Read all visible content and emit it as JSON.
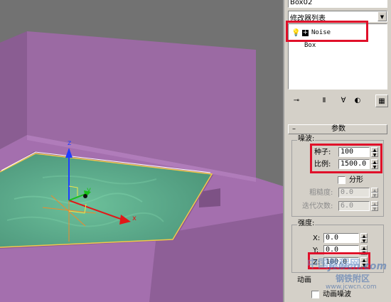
{
  "viewport": {
    "axes": {
      "x": "x",
      "y": "y",
      "z": "z"
    }
  },
  "panel": {
    "object_name": "Box02",
    "modifier_list_label": "修改器列表",
    "stack": [
      {
        "label": "Noise",
        "selected": true
      },
      {
        "label": "Box",
        "selected": false
      }
    ],
    "rollout": {
      "title": "参数",
      "noise_group": "噪波:",
      "seed_label": "种子:",
      "seed_value": "100",
      "scale_label": "比例:",
      "scale_value": "1500.0",
      "fractal_label": "分形",
      "roughness_label": "粗糙度:",
      "roughness_value": "0.0",
      "iterations_label": "迭代次数:",
      "iterations_value": "6.0",
      "strength_group": "强度:",
      "x_label": "X:",
      "x_value": "0.0",
      "y_label": "Y:",
      "y_value": "0.0",
      "z_label": "Z:",
      "z_value": "100.0",
      "animation_group": "动画",
      "animate_noise_label": "动画噪波"
    },
    "toolbar_icons": [
      "pin-stack-icon",
      "show-end-result-icon",
      "make-unique-icon",
      "remove-modifier-icon",
      "configure-modifier-sets-icon"
    ]
  },
  "colors": {
    "annotation_red": "#e0102a",
    "wall_purple": "#9b6aa3",
    "plane_green": "#5fa98a",
    "panel_gray": "#d4d0c8"
  },
  "watermark": {
    "logo_text": "中国教程网",
    "site_text": "jcwcn.com",
    "sub_text": "钢铁附区",
    "url_text": "www.jcwcn.com"
  }
}
